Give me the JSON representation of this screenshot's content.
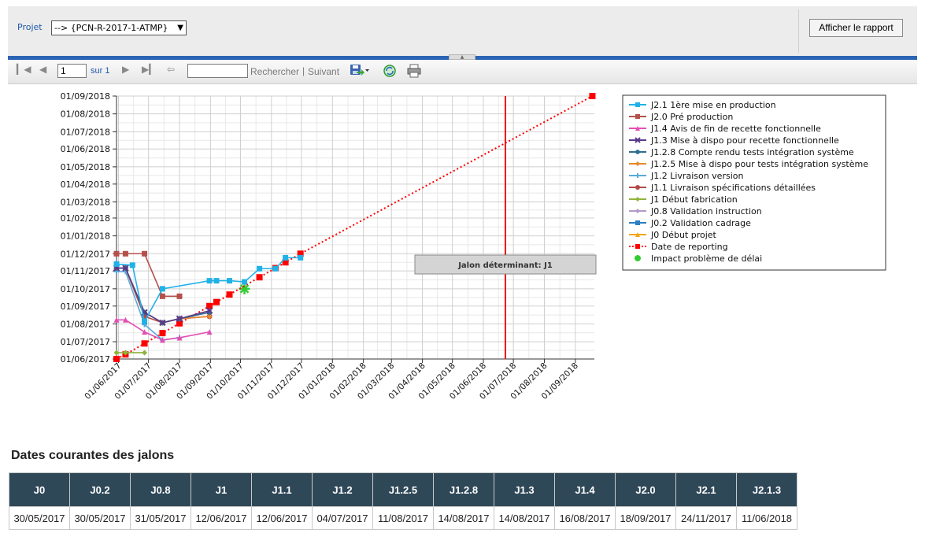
{
  "params": {
    "project_label": "Projet",
    "project_value": "--> {PCN-R-2017-1-ATMP}",
    "view_report_label": "Afficher le rapport"
  },
  "toolbar": {
    "page_current": "1",
    "page_of": "sur 1",
    "find_label": "Rechercher",
    "find_separator": "|",
    "next_label": "Suivant",
    "search_placeholder": "",
    "icons": [
      "first-page-icon",
      "previous-page-icon",
      "next-page-icon",
      "last-page-icon",
      "back-icon",
      "export-save-icon",
      "refresh-icon",
      "print-icon"
    ]
  },
  "chart_data": {
    "type": "line",
    "x_axis": {
      "ticks": [
        "01/06/2017",
        "01/07/2017",
        "01/08/2017",
        "01/09/2017",
        "01/10/2017",
        "01/11/2017",
        "01/12/2017",
        "01/01/2018",
        "01/02/2018",
        "01/03/2018",
        "01/04/2018",
        "01/05/2018",
        "01/06/2018",
        "01/07/2018",
        "01/08/2018",
        "01/09/2018"
      ],
      "range": [
        "2017-05-30",
        "2018-09-20"
      ]
    },
    "y_axis": {
      "ticks": [
        "01/06/2017",
        "01/07/2017",
        "01/08/2017",
        "01/09/2017",
        "01/10/2017",
        "01/11/2017",
        "01/12/2017",
        "01/01/2018",
        "01/02/2018",
        "01/03/2018",
        "01/04/2018",
        "01/05/2018",
        "01/06/2018",
        "01/07/2018",
        "01/08/2018",
        "01/09/2018"
      ],
      "range": [
        "2017-06-01",
        "2018-09-01"
      ]
    },
    "grid": true,
    "legend_position": "right",
    "annotation": "Jalon déterminant: J1",
    "vertical_marker_x": "2018-06-23",
    "series": [
      {
        "name": "J2.1 1ère mise en production",
        "color": "#1fb2e8",
        "marker": "square",
        "points": [
          [
            "2017-05-30",
            "2017-11-13"
          ],
          [
            "2017-06-15",
            "2017-11-11"
          ],
          [
            "2017-06-27",
            "2017-08-05"
          ],
          [
            "2017-07-15",
            "2017-10-01"
          ],
          [
            "2017-08-31",
            "2017-10-15"
          ],
          [
            "2017-09-07",
            "2017-10-15"
          ],
          [
            "2017-09-20",
            "2017-10-15"
          ],
          [
            "2017-10-05",
            "2017-10-13"
          ],
          [
            "2017-10-20",
            "2017-11-05"
          ],
          [
            "2017-11-05",
            "2017-11-05"
          ],
          [
            "2017-11-15",
            "2017-11-24"
          ],
          [
            "2017-11-30",
            "2017-11-24"
          ]
        ]
      },
      {
        "name": "J2.0 Pré production",
        "color": "#b5514c",
        "marker": "square",
        "points": [
          [
            "2017-05-30",
            "2017-12-01"
          ],
          [
            "2017-06-08",
            "2017-12-01"
          ],
          [
            "2017-06-27",
            "2017-12-01"
          ],
          [
            "2017-07-15",
            "2017-09-18"
          ],
          [
            "2017-08-01",
            "2017-09-18"
          ]
        ]
      },
      {
        "name": "J1.4 Avis de fin de recette fonctionnelle",
        "color": "#e24fb4",
        "marker": "triangle",
        "points": [
          [
            "2017-05-30",
            "2017-08-08"
          ],
          [
            "2017-06-08",
            "2017-08-08"
          ],
          [
            "2017-06-27",
            "2017-07-18"
          ],
          [
            "2017-07-15",
            "2017-07-04"
          ],
          [
            "2017-08-01",
            "2017-07-08"
          ],
          [
            "2017-08-31",
            "2017-07-18"
          ]
        ]
      },
      {
        "name": "J1.3 Mise à dispo pour recette fonctionnelle",
        "color": "#5a3a8a",
        "marker": "x",
        "points": [
          [
            "2017-05-30",
            "2017-11-06"
          ],
          [
            "2017-06-08",
            "2017-11-06"
          ],
          [
            "2017-06-27",
            "2017-08-21"
          ],
          [
            "2017-07-15",
            "2017-08-03"
          ],
          [
            "2017-08-01",
            "2017-08-10"
          ],
          [
            "2017-08-31",
            "2017-08-24"
          ]
        ]
      },
      {
        "name": "J1.2.8 Compte rendu tests intégration système",
        "color": "#2e6e8e",
        "marker": "star",
        "points": [
          [
            "2017-05-30",
            "2017-11-06"
          ],
          [
            "2017-06-08",
            "2017-11-06"
          ],
          [
            "2017-06-27",
            "2017-08-21"
          ],
          [
            "2017-07-15",
            "2017-08-03"
          ],
          [
            "2017-08-01",
            "2017-08-10"
          ],
          [
            "2017-08-31",
            "2017-08-21"
          ]
        ]
      },
      {
        "name": "J1.2.5 Mise à dispo pour tests intégration système",
        "color": "#e88a2a",
        "marker": "diamond",
        "points": [
          [
            "2017-05-30",
            "2017-11-06"
          ],
          [
            "2017-06-08",
            "2017-11-06"
          ],
          [
            "2017-06-27",
            "2017-08-21"
          ],
          [
            "2017-07-15",
            "2017-08-03"
          ],
          [
            "2017-08-01",
            "2017-08-10"
          ],
          [
            "2017-08-31",
            "2017-08-14"
          ]
        ]
      },
      {
        "name": "J1.2 Livraison version",
        "color": "#5aaad8",
        "marker": "plus",
        "points": [
          [
            "2017-05-30",
            "2017-10-31"
          ],
          [
            "2017-06-08",
            "2017-10-31"
          ],
          [
            "2017-06-27",
            "2017-07-31"
          ],
          [
            "2017-07-15",
            "2017-07-04"
          ],
          [
            "2017-08-01",
            "2017-07-08"
          ]
        ]
      },
      {
        "name": "J1.1 Livraison spécifications détaillées",
        "color": "#b04a48",
        "marker": "circle",
        "points": [
          [
            "2017-05-30",
            "2017-11-06"
          ],
          [
            "2017-06-08",
            "2017-11-06"
          ],
          [
            "2017-06-27",
            "2017-08-14"
          ],
          [
            "2017-07-15",
            "2017-08-03"
          ],
          [
            "2017-08-01",
            "2017-08-10"
          ],
          [
            "2017-08-31",
            "2017-08-14"
          ]
        ]
      },
      {
        "name": "J1 Début fabrication",
        "color": "#8fb33c",
        "marker": "diamond",
        "points": [
          [
            "2017-05-30",
            "2017-06-12"
          ],
          [
            "2017-06-08",
            "2017-06-12"
          ],
          [
            "2017-06-27",
            "2017-06-12"
          ]
        ]
      },
      {
        "name": "J0.8 Validation instruction",
        "color": "#b29ac8",
        "marker": "diamond",
        "points": []
      },
      {
        "name": "J0.2 Validation cadrage",
        "color": "#2b7fc2",
        "marker": "square",
        "points": []
      },
      {
        "name": "J0 Début projet",
        "color": "#f2a51a",
        "marker": "triangle",
        "points": []
      },
      {
        "name": "Date de reporting",
        "color": "#ff0000",
        "marker": "square",
        "dotted": true,
        "points": [
          [
            "2017-05-30",
            "2017-06-01"
          ],
          [
            "2017-06-08",
            "2017-06-09"
          ],
          [
            "2017-06-27",
            "2017-06-28"
          ],
          [
            "2017-07-15",
            "2017-07-16"
          ],
          [
            "2017-08-01",
            "2017-08-02"
          ],
          [
            "2017-08-31",
            "2017-09-01"
          ],
          [
            "2017-09-07",
            "2017-09-08"
          ],
          [
            "2017-09-20",
            "2017-09-21"
          ],
          [
            "2017-10-20",
            "2017-10-21"
          ],
          [
            "2017-11-05",
            "2017-11-06"
          ],
          [
            "2017-11-15",
            "2017-11-16"
          ],
          [
            "2017-11-30",
            "2017-12-01"
          ],
          [
            "2018-09-18",
            "2018-09-01"
          ]
        ]
      },
      {
        "name": "Impact problème de délai",
        "color": "#33cc33",
        "marker": "asterisk",
        "points": [
          [
            "2017-10-05",
            "2017-10-01"
          ]
        ]
      }
    ]
  },
  "table": {
    "title": "Dates courantes des jalons",
    "headers": [
      "J0",
      "J0.2",
      "J0.8",
      "J1",
      "J1.1",
      "J1.2",
      "J1.2.5",
      "J1.2.8",
      "J1.3",
      "J1.4",
      "J2.0",
      "J2.1",
      "J2.1.3"
    ],
    "rows": [
      [
        "30/05/2017",
        "30/05/2017",
        "31/05/2017",
        "12/06/2017",
        "12/06/2017",
        "04/07/2017",
        "11/08/2017",
        "14/08/2017",
        "14/08/2017",
        "16/08/2017",
        "18/09/2017",
        "24/11/2017",
        "11/06/2018"
      ]
    ]
  }
}
